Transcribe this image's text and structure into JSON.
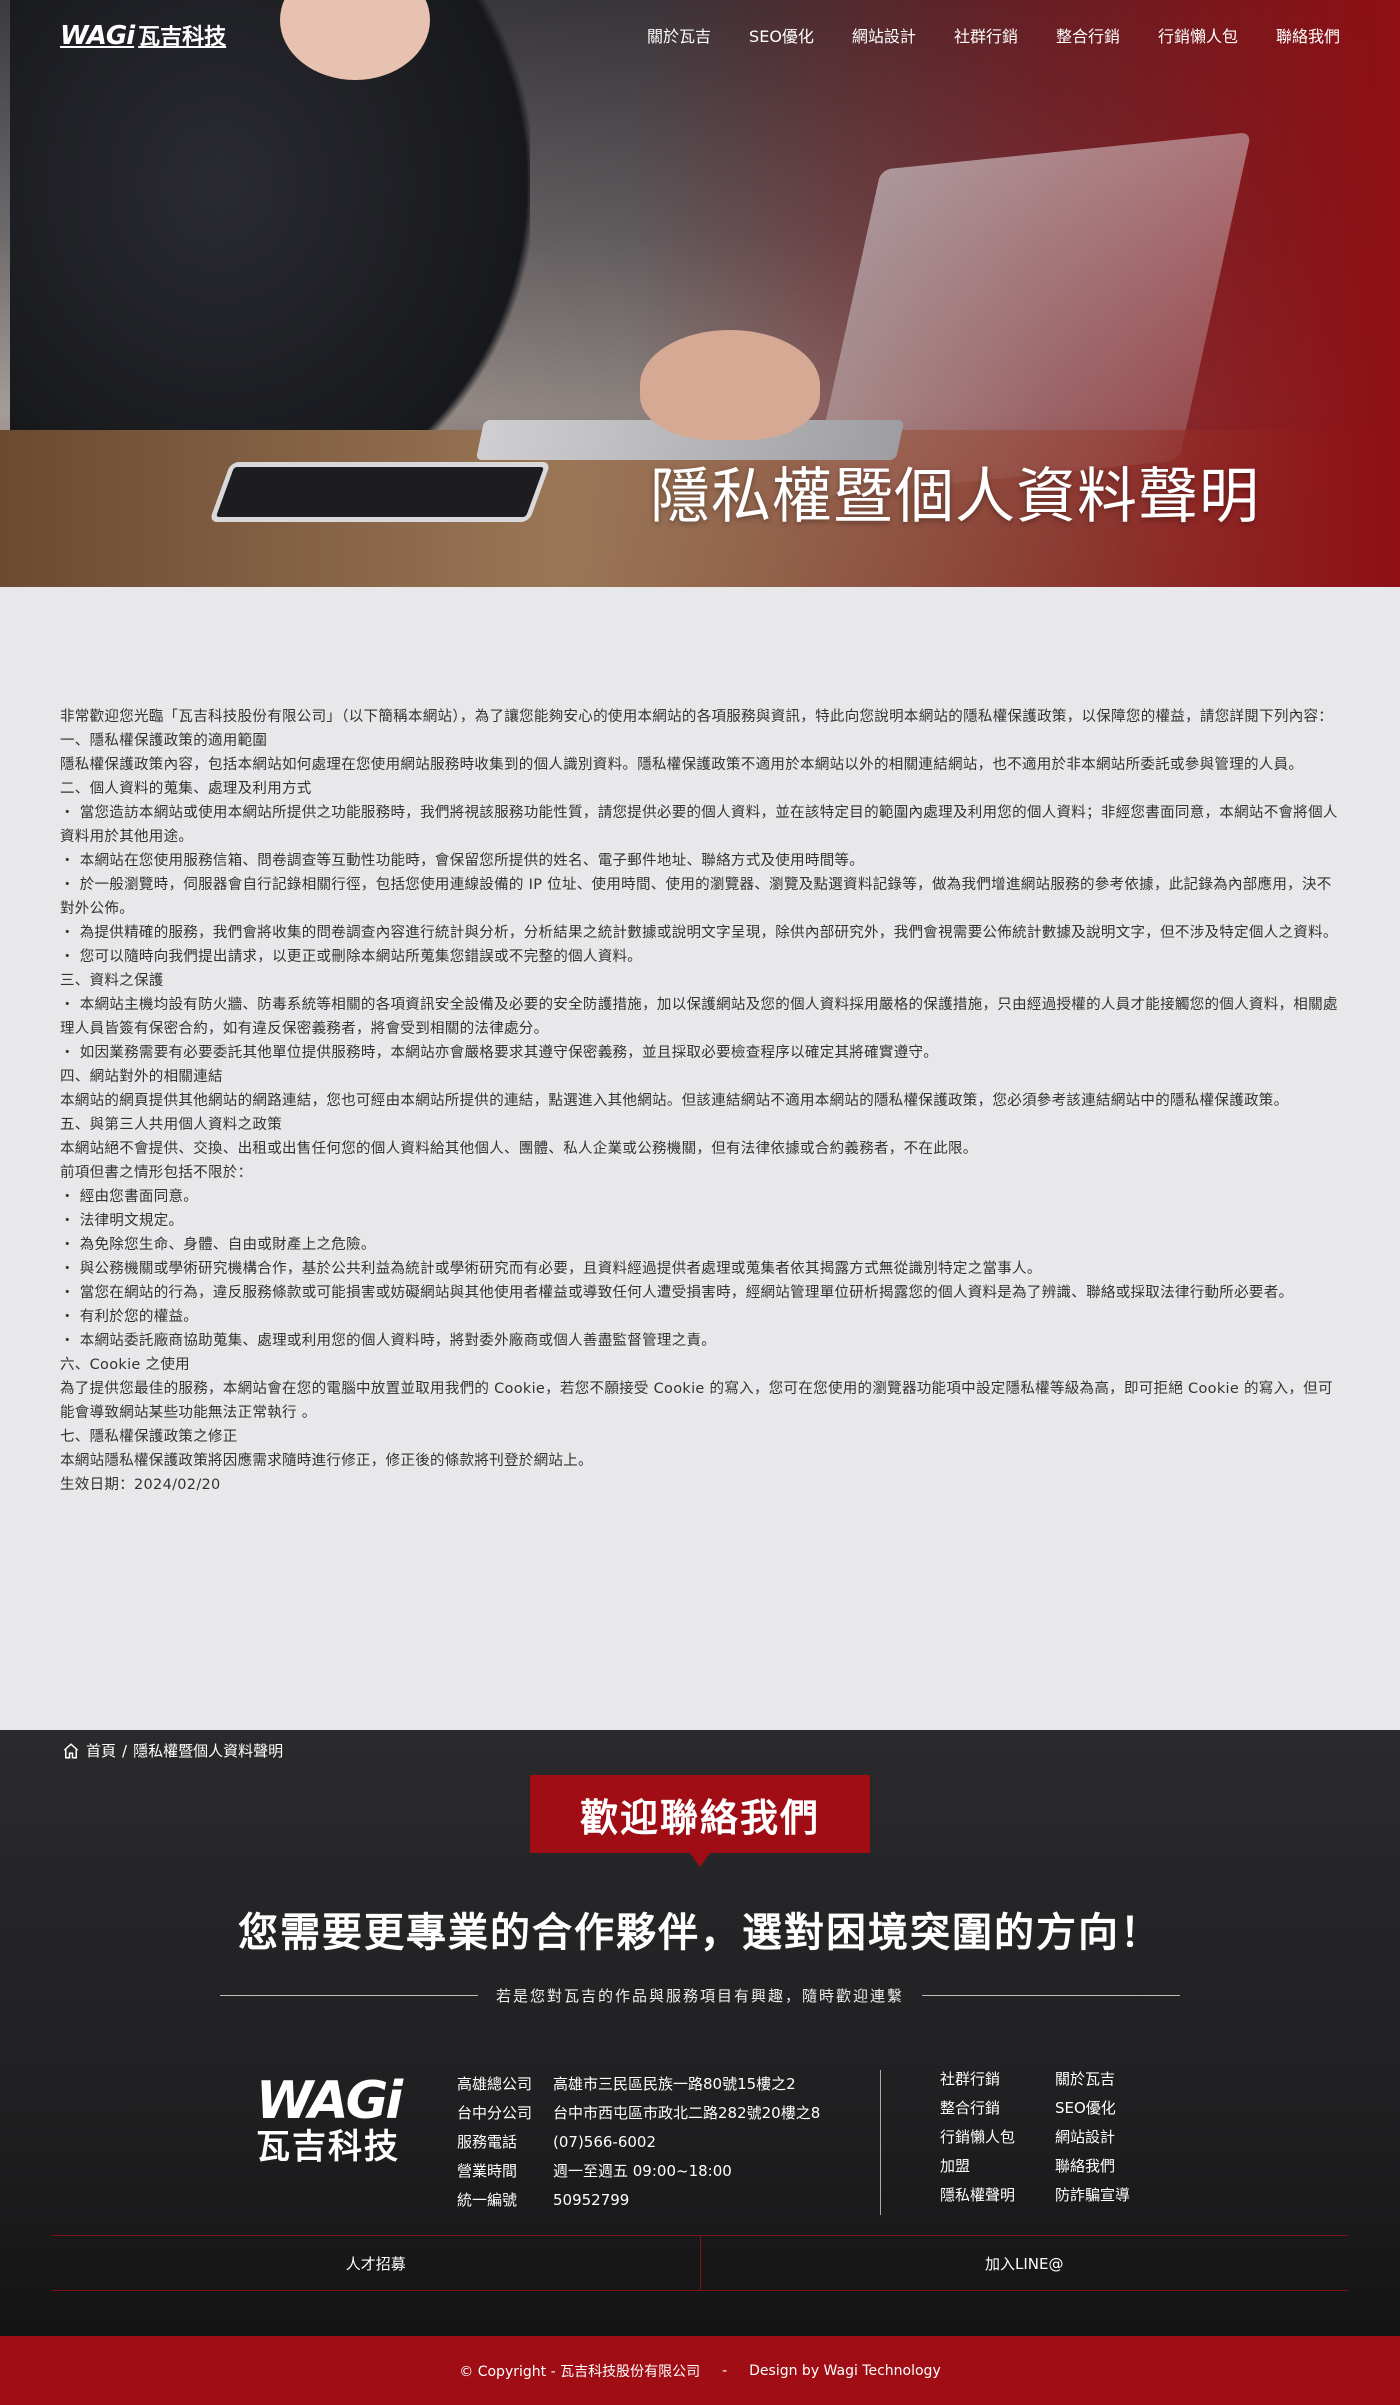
{
  "header": {
    "logo_latin": "WAGi",
    "logo_cjk": "瓦吉科技",
    "nav": [
      "關於瓦吉",
      "SEO優化",
      "網站設計",
      "社群行銷",
      "整合行銷",
      "行銷懶人包",
      "聯絡我們"
    ]
  },
  "hero": {
    "title": "隱私權暨個人資料聲明"
  },
  "policy": {
    "paragraphs": [
      "非常歡迎您光臨「瓦吉科技股份有限公司」（以下簡稱本網站），為了讓您能夠安心的使用本網站的各項服務與資訊，特此向您說明本網站的隱私權保護政策，以保障您的權益，請您詳閱下列內容：",
      "一、隱私權保護政策的適用範圍",
      "隱私權保護政策內容，包括本網站如何處理在您使用網站服務時收集到的個人識別資料。隱私權保護政策不適用於本網站以外的相關連結網站，也不適用於非本網站所委託或參與管理的人員。",
      "二、個人資料的蒐集、處理及利用方式",
      "・ 當您造訪本網站或使用本網站所提供之功能服務時，我們將視該服務功能性質，請您提供必要的個人資料，並在該特定目的範圍內處理及利用您的個人資料；非經您書面同意，本網站不會將個人資料用於其他用途。",
      "・ 本網站在您使用服務信箱、問卷調查等互動性功能時，會保留您所提供的姓名、電子郵件地址、聯絡方式及使用時間等。",
      "・ 於一般瀏覽時，伺服器會自行記錄相關行徑，包括您使用連線設備的 IP 位址、使用時間、使用的瀏覽器、瀏覽及點選資料記錄等，做為我們增進網站服務的參考依據，此記錄為內部應用，決不對外公佈。",
      "・ 為提供精確的服務，我們會將收集的問卷調查內容進行統計與分析，分析結果之統計數據或說明文字呈現，除供內部研究外，我們會視需要公佈統計數據及說明文字，但不涉及特定個人之資料。",
      "・ 您可以隨時向我們提出請求，以更正或刪除本網站所蒐集您錯誤或不完整的個人資料。",
      "三、資料之保護",
      "・ 本網站主機均設有防火牆、防毒系統等相關的各項資訊安全設備及必要的安全防護措施，加以保護網站及您的個人資料採用嚴格的保護措施，只由經過授權的人員才能接觸您的個人資料，相關處理人員皆簽有保密合約，如有違反保密義務者，將會受到相關的法律處分。",
      "・ 如因業務需要有必要委託其他單位提供服務時，本網站亦會嚴格要求其遵守保密義務，並且採取必要檢查程序以確定其將確實遵守。",
      "四、網站對外的相關連結",
      "本網站的網頁提供其他網站的網路連結，您也可經由本網站所提供的連結，點選進入其他網站。但該連結網站不適用本網站的隱私權保護政策，您必須參考該連結網站中的隱私權保護政策。",
      "五、與第三人共用個人資料之政策",
      "本網站絕不會提供、交換、出租或出售任何您的個人資料給其他個人、團體、私人企業或公務機關，但有法律依據或合約義務者，不在此限。",
      "前項但書之情形包括不限於：",
      "・ 經由您書面同意。",
      "・ 法律明文規定。",
      "・ 為免除您生命、身體、自由或財產上之危險。",
      "・ 與公務機關或學術研究機構合作，基於公共利益為統計或學術研究而有必要，且資料經過提供者處理或蒐集者依其揭露方式無從識別特定之當事人。",
      "・ 當您在網站的行為，違反服務條款或可能損害或妨礙網站與其他使用者權益或導致任何人遭受損害時，經網站管理單位研析揭露您的個人資料是為了辨識、聯絡或採取法律行動所必要者。",
      "・ 有利於您的權益。",
      "・ 本網站委託廠商協助蒐集、處理或利用您的個人資料時，將對委外廠商或個人善盡監督管理之責。",
      "六、Cookie 之使用",
      "為了提供您最佳的服務，本網站會在您的電腦中放置並取用我們的 Cookie，若您不願接受 Cookie 的寫入，您可在您使用的瀏覽器功能項中設定隱私權等級為高，即可拒絕 Cookie 的寫入，但可能會導致網站某些功能無法正常執行 。",
      "七、隱私權保護政策之修正",
      "本網站隱私權保護政策將因應需求隨時進行修正，修正後的條款將刊登於網站上。",
      "生效日期：2024/02/20"
    ]
  },
  "breadcrumb": {
    "home": "首頁",
    "separator": "/",
    "current": "隱私權暨個人資料聲明"
  },
  "contact": {
    "badge": "歡迎聯絡我們",
    "headline": "您需要更專業的合作夥伴，選對困境突圍的方向！",
    "subline": "若是您對瓦吉的作品與服務項目有興趣，隨時歡迎連繫"
  },
  "footer": {
    "logo_latin": "WAGi",
    "logo_cjk": "瓦吉科技",
    "info": [
      {
        "k": "高雄總公司",
        "v": "高雄市三民區民族一路80號15樓之2"
      },
      {
        "k": "台中分公司",
        "v": "台中市西屯區市政北二路282號20樓之8"
      },
      {
        "k": "服務電話",
        "v": "(07)566-6002"
      },
      {
        "k": "營業時間",
        "v": "週一至週五 09:00~18:00"
      },
      {
        "k": "統一編號",
        "v": "50952799"
      }
    ],
    "links": [
      "社群行銷",
      "關於瓦吉",
      "整合行銷",
      "SEO優化",
      "行銷懶人包",
      "網站設計",
      "加盟",
      "聯絡我們",
      "隱私權聲明",
      "防詐騙宣導"
    ],
    "bar": [
      "人才招募",
      "加入LINE@"
    ],
    "copyright": "© Copyright - 瓦吉科技股份有限公司",
    "copyright_sep": "-",
    "design": "Design by Wagi Technology"
  },
  "colors": {
    "brand_red": "#a00d14",
    "dark_bg": "#202022",
    "content_bg": "#e8e8ea"
  }
}
